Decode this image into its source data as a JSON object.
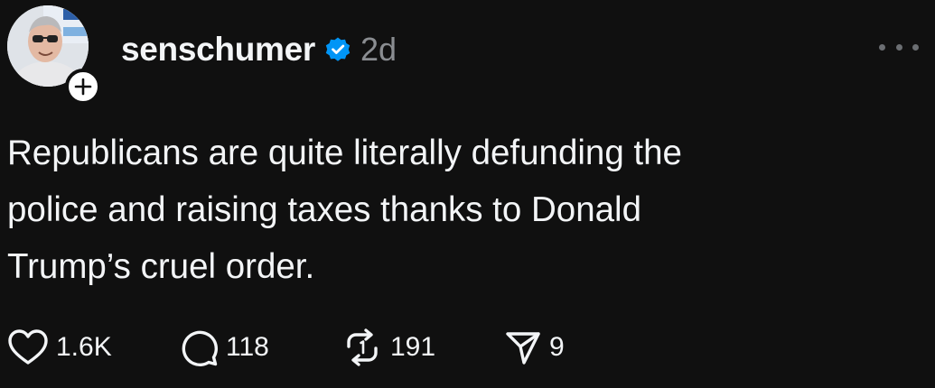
{
  "post": {
    "username": "senschumer",
    "timestamp": "2d",
    "text_lines": [
      "Republicans are quite literally defunding the",
      "police and raising taxes thanks to Donald",
      "Trump’s cruel order."
    ],
    "actions": {
      "like_count": "1.6K",
      "reply_count": "118",
      "repost_count": "191",
      "share_count": "9"
    }
  },
  "icons": {
    "verified": "verified-badge-icon",
    "follow": "plus-icon",
    "more": "more-horizontal-icon",
    "like": "heart-icon",
    "reply": "comment-icon",
    "repost": "repost-icon",
    "share": "send-icon"
  },
  "colors": {
    "background": "#101010",
    "text": "#f3f5f7",
    "muted": "#8a8d91",
    "verified": "#0095f6"
  }
}
